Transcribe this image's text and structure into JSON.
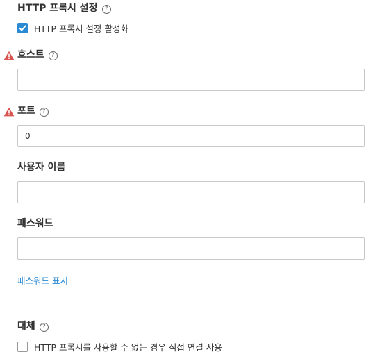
{
  "http_proxy": {
    "section_title": "HTTP 프록시 설정",
    "enable_label": "HTTP 프록시 설정 활성화",
    "enabled": true
  },
  "host": {
    "label": "호스트",
    "value": "",
    "has_error": true
  },
  "port": {
    "label": "포트",
    "value": "0",
    "has_error": true
  },
  "username": {
    "label": "사용자 이름",
    "value": ""
  },
  "password": {
    "label": "패스워드",
    "value": "",
    "show_label": "패스워드 표시"
  },
  "fallback": {
    "section_title": "대체",
    "direct_label": "HTTP 프록시를 사용할 수 없는 경우 직접 연결 사용",
    "enabled": false
  },
  "icons": {
    "help": "help-circle-icon",
    "warning": "warning-icon",
    "check": "checkmark-icon"
  },
  "colors": {
    "accent": "#2a8ad4",
    "warning": "#d9534f",
    "text": "#333333",
    "border": "#c8c8c8"
  }
}
